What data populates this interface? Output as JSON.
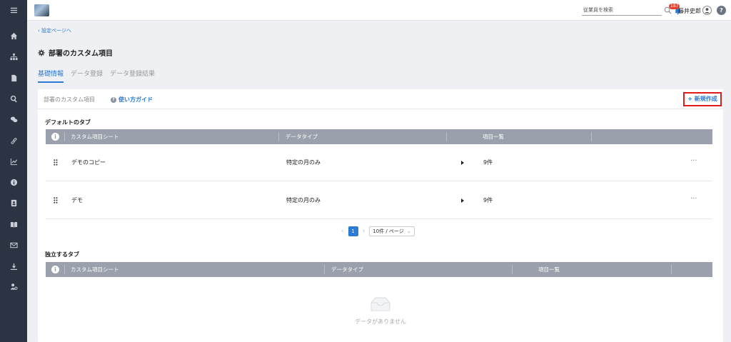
{
  "topbar": {
    "search_placeholder": "従業員を検索",
    "notification_count": "187",
    "user_name": "藤井史郎",
    "help_label": "?"
  },
  "page": {
    "back_link": "設定ページへ",
    "title": "部署のカスタム項目",
    "tabs": [
      {
        "label": "基礎情報",
        "active": true
      },
      {
        "label": "データ登録",
        "active": false
      },
      {
        "label": "データ登録結果",
        "active": false
      }
    ]
  },
  "card": {
    "title": "部署のカスタム項目",
    "guide_label": "使い方ガイド",
    "new_button": "+ 新規作成"
  },
  "default_tabs": {
    "title": "デフォルトのタブ",
    "columns": [
      "カスタム項目シート",
      "データタイプ",
      "項目一覧"
    ],
    "rows": [
      {
        "name": "デモのコピー",
        "data_type": "特定の月のみ",
        "count": "9件"
      },
      {
        "name": "デモ",
        "data_type": "特定の月のみ",
        "count": "9件"
      }
    ],
    "pagination": {
      "current_page": "1",
      "page_size": "10件 / ページ"
    }
  },
  "independent_tabs": {
    "title": "独立するタブ",
    "columns": [
      "カスタム項目シート",
      "データタイプ",
      "項目一覧"
    ],
    "empty_text": "データがありません"
  },
  "colors": {
    "accent": "#2a7ad6",
    "sidebar": "#2b3443",
    "table_header": "#9aa0ac",
    "highlight": "#e01d1d"
  },
  "icons": [
    "menu-icon",
    "home-icon",
    "org-chart-icon",
    "document-icon",
    "search-icon",
    "chat-icon",
    "link-icon",
    "chart-icon",
    "info-icon",
    "contact-icon",
    "book-icon",
    "mail-icon",
    "download-icon",
    "user-settings-icon"
  ]
}
